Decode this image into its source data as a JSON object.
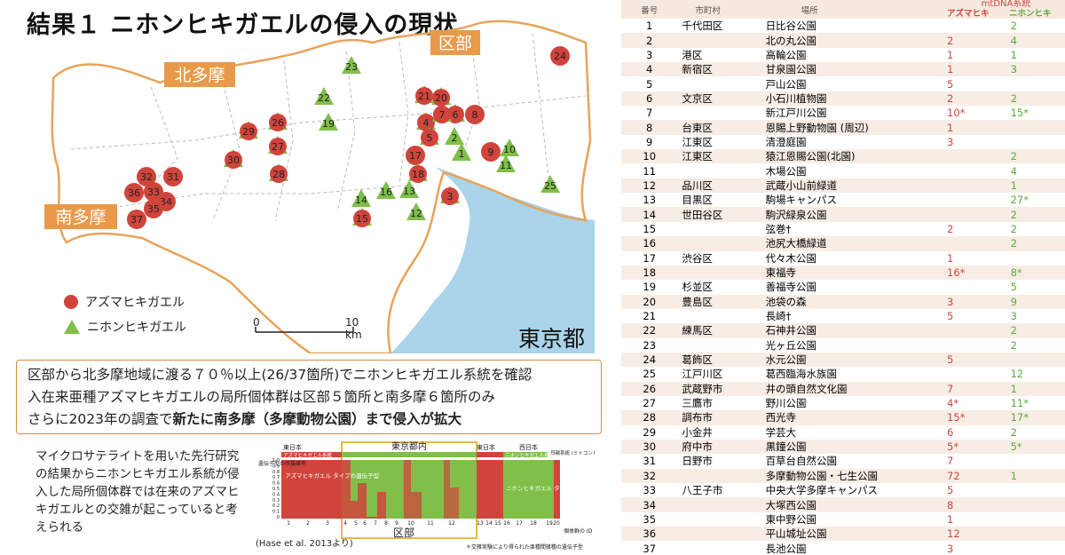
{
  "slide": {
    "title": "結果１ ニホンヒキガエルの侵入の現状",
    "regions": {
      "kitatama": "北多摩",
      "kubu": "区部",
      "minamitama": "南多摩"
    },
    "map_label": "東京都",
    "legend": {
      "azuma": "アズマヒキガエル",
      "nihon": "ニホンヒキガエル"
    },
    "scale": {
      "start": "0",
      "end": "10 km"
    },
    "colors": {
      "azuma": "#d0443c",
      "nihon": "#7fbf4a",
      "sea": "#a9d4ea",
      "region_label": "#e89a4a"
    },
    "markers_azuma": [
      "1",
      "2",
      "3",
      "4",
      "5",
      "6",
      "7",
      "8",
      "9",
      "10",
      "11",
      "12",
      "13",
      "14",
      "15",
      "16",
      "17",
      "18",
      "19",
      "20",
      "21",
      "22",
      "23",
      "24",
      "25",
      "26",
      "27",
      "28",
      "29",
      "30",
      "31",
      "32",
      "33",
      "34",
      "35",
      "36",
      "37"
    ],
    "summary": {
      "line1": "区部から北多摩地域に渡る７０％以上(26/37箇所)でニホンヒキガエル系統を確認",
      "line2": "入在来亜種アズマヒキガエルの局所個体群は区部５箇所と南多摩６箇所のみ",
      "line3_pre": "さらに2023年の調査で",
      "line3_bold": "新たに南多摩（多摩動物公園）まで侵入が拡大"
    },
    "micro_text": "マイクロサテライトを用いた先行研究の結果からニホンヒキガエル系統が侵入した局所個体群では在来のアズマヒキガエルとの交雑が起こっていると考えられる",
    "structure": {
      "east_left": "東日本",
      "tokyo_in": "東京都内",
      "east_right": "東日本",
      "west": "西日本",
      "mt_label": "母親系統 (ミトコンドリアDNA)",
      "azuma_lineage": "アズマヒキガエル系統",
      "nihon_lineage": "ニホンヒキガエル系統",
      "y_label": "遺伝子型の所属確率",
      "azuma_type": "アズマヒキガエル タイプの遺伝子型",
      "nihon_type": "ニホンヒキガエル タイプの遺伝子型",
      "yticks": [
        "1.0",
        "0.9",
        "0.8",
        "0.7",
        "0.6",
        "0.5",
        "0.4",
        "0.3",
        "0.2",
        "0.1",
        "0"
      ],
      "xticks": [
        "1",
        "2",
        "3",
        "4",
        "5",
        "6",
        "7",
        "8",
        "9",
        "10",
        "11",
        "12",
        "13",
        "14",
        "15",
        "16",
        "17",
        "18",
        "19",
        "20"
      ],
      "kubu": "区部",
      "id_label": "個体群の ID",
      "note": "＊交雑実験により得られた亜種間雑種の遺伝子型",
      "citation": "(Hase et al. 2013より)"
    }
  },
  "table": {
    "headers": {
      "no": "番号",
      "city": "市町村",
      "place": "場所",
      "mt": "mtDNA系統",
      "azuma": "アズマヒキ",
      "nihon": "ニホンヒキ"
    },
    "rows": [
      {
        "no": "1",
        "city": "千代田区",
        "place": "日比谷公園",
        "az": "",
        "ni": "2"
      },
      {
        "no": "2",
        "city": "",
        "place": "北の丸公園",
        "az": "2",
        "ni": "4"
      },
      {
        "no": "3",
        "city": "港区",
        "place": "高輪公園",
        "az": "1",
        "ni": "1"
      },
      {
        "no": "4",
        "city": "新宿区",
        "place": "甘泉園公園",
        "az": "1",
        "ni": "3"
      },
      {
        "no": "5",
        "city": "",
        "place": "戸山公園",
        "az": "5",
        "ni": ""
      },
      {
        "no": "6",
        "city": "文京区",
        "place": "小石川植物園",
        "az": "2",
        "ni": "2"
      },
      {
        "no": "7",
        "city": "",
        "place": "新江戸川公園",
        "az": "10*",
        "ni": "15*"
      },
      {
        "no": "8",
        "city": "台東区",
        "place": "恩賜上野動物園 (周辺)",
        "az": "1",
        "ni": ""
      },
      {
        "no": "9",
        "city": "江東区",
        "place": "清澄庭園",
        "az": "3",
        "ni": ""
      },
      {
        "no": "10",
        "city": "江東区",
        "place": "猿江恩賜公園(北園)",
        "az": "",
        "ni": "2"
      },
      {
        "no": "11",
        "city": "",
        "place": "木場公園",
        "az": "",
        "ni": "4"
      },
      {
        "no": "12",
        "city": "品川区",
        "place": "武蔵小山前緑道",
        "az": "",
        "ni": "1"
      },
      {
        "no": "13",
        "city": "目黒区",
        "place": "駒場キャンパス",
        "az": "",
        "ni": "27*"
      },
      {
        "no": "14",
        "city": "世田谷区",
        "place": "駒沢緑泉公園",
        "az": "",
        "ni": "2"
      },
      {
        "no": "15",
        "city": "",
        "place": "弦巻†",
        "az": "2",
        "ni": "2"
      },
      {
        "no": "16",
        "city": "",
        "place": "池尻大橋緑道",
        "az": "",
        "ni": "2"
      },
      {
        "no": "17",
        "city": "渋谷区",
        "place": "代々木公園",
        "az": "1",
        "ni": ""
      },
      {
        "no": "18",
        "city": "",
        "place": "東福寺",
        "az": "16*",
        "ni": "8*"
      },
      {
        "no": "19",
        "city": "杉並区",
        "place": "善福寺公園",
        "az": "",
        "ni": "5"
      },
      {
        "no": "20",
        "city": "豊島区",
        "place": "池袋の森",
        "az": "3",
        "ni": "9"
      },
      {
        "no": "21",
        "city": "",
        "place": "長崎†",
        "az": "5",
        "ni": "3"
      },
      {
        "no": "22",
        "city": "練馬区",
        "place": "石神井公園",
        "az": "",
        "ni": "2"
      },
      {
        "no": "23",
        "city": "",
        "place": "光ヶ丘公園",
        "az": "",
        "ni": "2"
      },
      {
        "no": "24",
        "city": "葛飾区",
        "place": "水元公園",
        "az": "5",
        "ni": ""
      },
      {
        "no": "25",
        "city": "江戸川区",
        "place": "葛西臨海水族園",
        "az": "",
        "ni": "12"
      },
      {
        "no": "26",
        "city": "武蔵野市",
        "place": "井の頭自然文化園",
        "az": "7",
        "ni": "1"
      },
      {
        "no": "27",
        "city": "三鷹市",
        "place": "野川公園",
        "az": "4*",
        "ni": "11*"
      },
      {
        "no": "28",
        "city": "調布市",
        "place": "西光寺",
        "az": "15*",
        "ni": "17*"
      },
      {
        "no": "29",
        "city": "小金井",
        "place": "学芸大",
        "az": "6",
        "ni": "2"
      },
      {
        "no": "30",
        "city": "府中市",
        "place": "黒鐘公園",
        "az": "5*",
        "ni": "5*"
      },
      {
        "no": "31",
        "city": "日野市",
        "place": "百草台自然公園",
        "az": "7",
        "ni": ""
      },
      {
        "no": "32",
        "city": "",
        "place": "多摩動物公園・七生公園",
        "az": "72",
        "ni": "1"
      },
      {
        "no": "33",
        "city": "八王子市",
        "place": "中央大学多摩キャンパス",
        "az": "5",
        "ni": ""
      },
      {
        "no": "34",
        "city": "",
        "place": "大塚西公園",
        "az": "8",
        "ni": ""
      },
      {
        "no": "35",
        "city": "",
        "place": "東中野公園",
        "az": "1",
        "ni": ""
      },
      {
        "no": "36",
        "city": "",
        "place": "平山城址公園",
        "az": "12",
        "ni": ""
      },
      {
        "no": "37",
        "city": "",
        "place": "長池公園",
        "az": "3",
        "ni": ""
      }
    ]
  }
}
